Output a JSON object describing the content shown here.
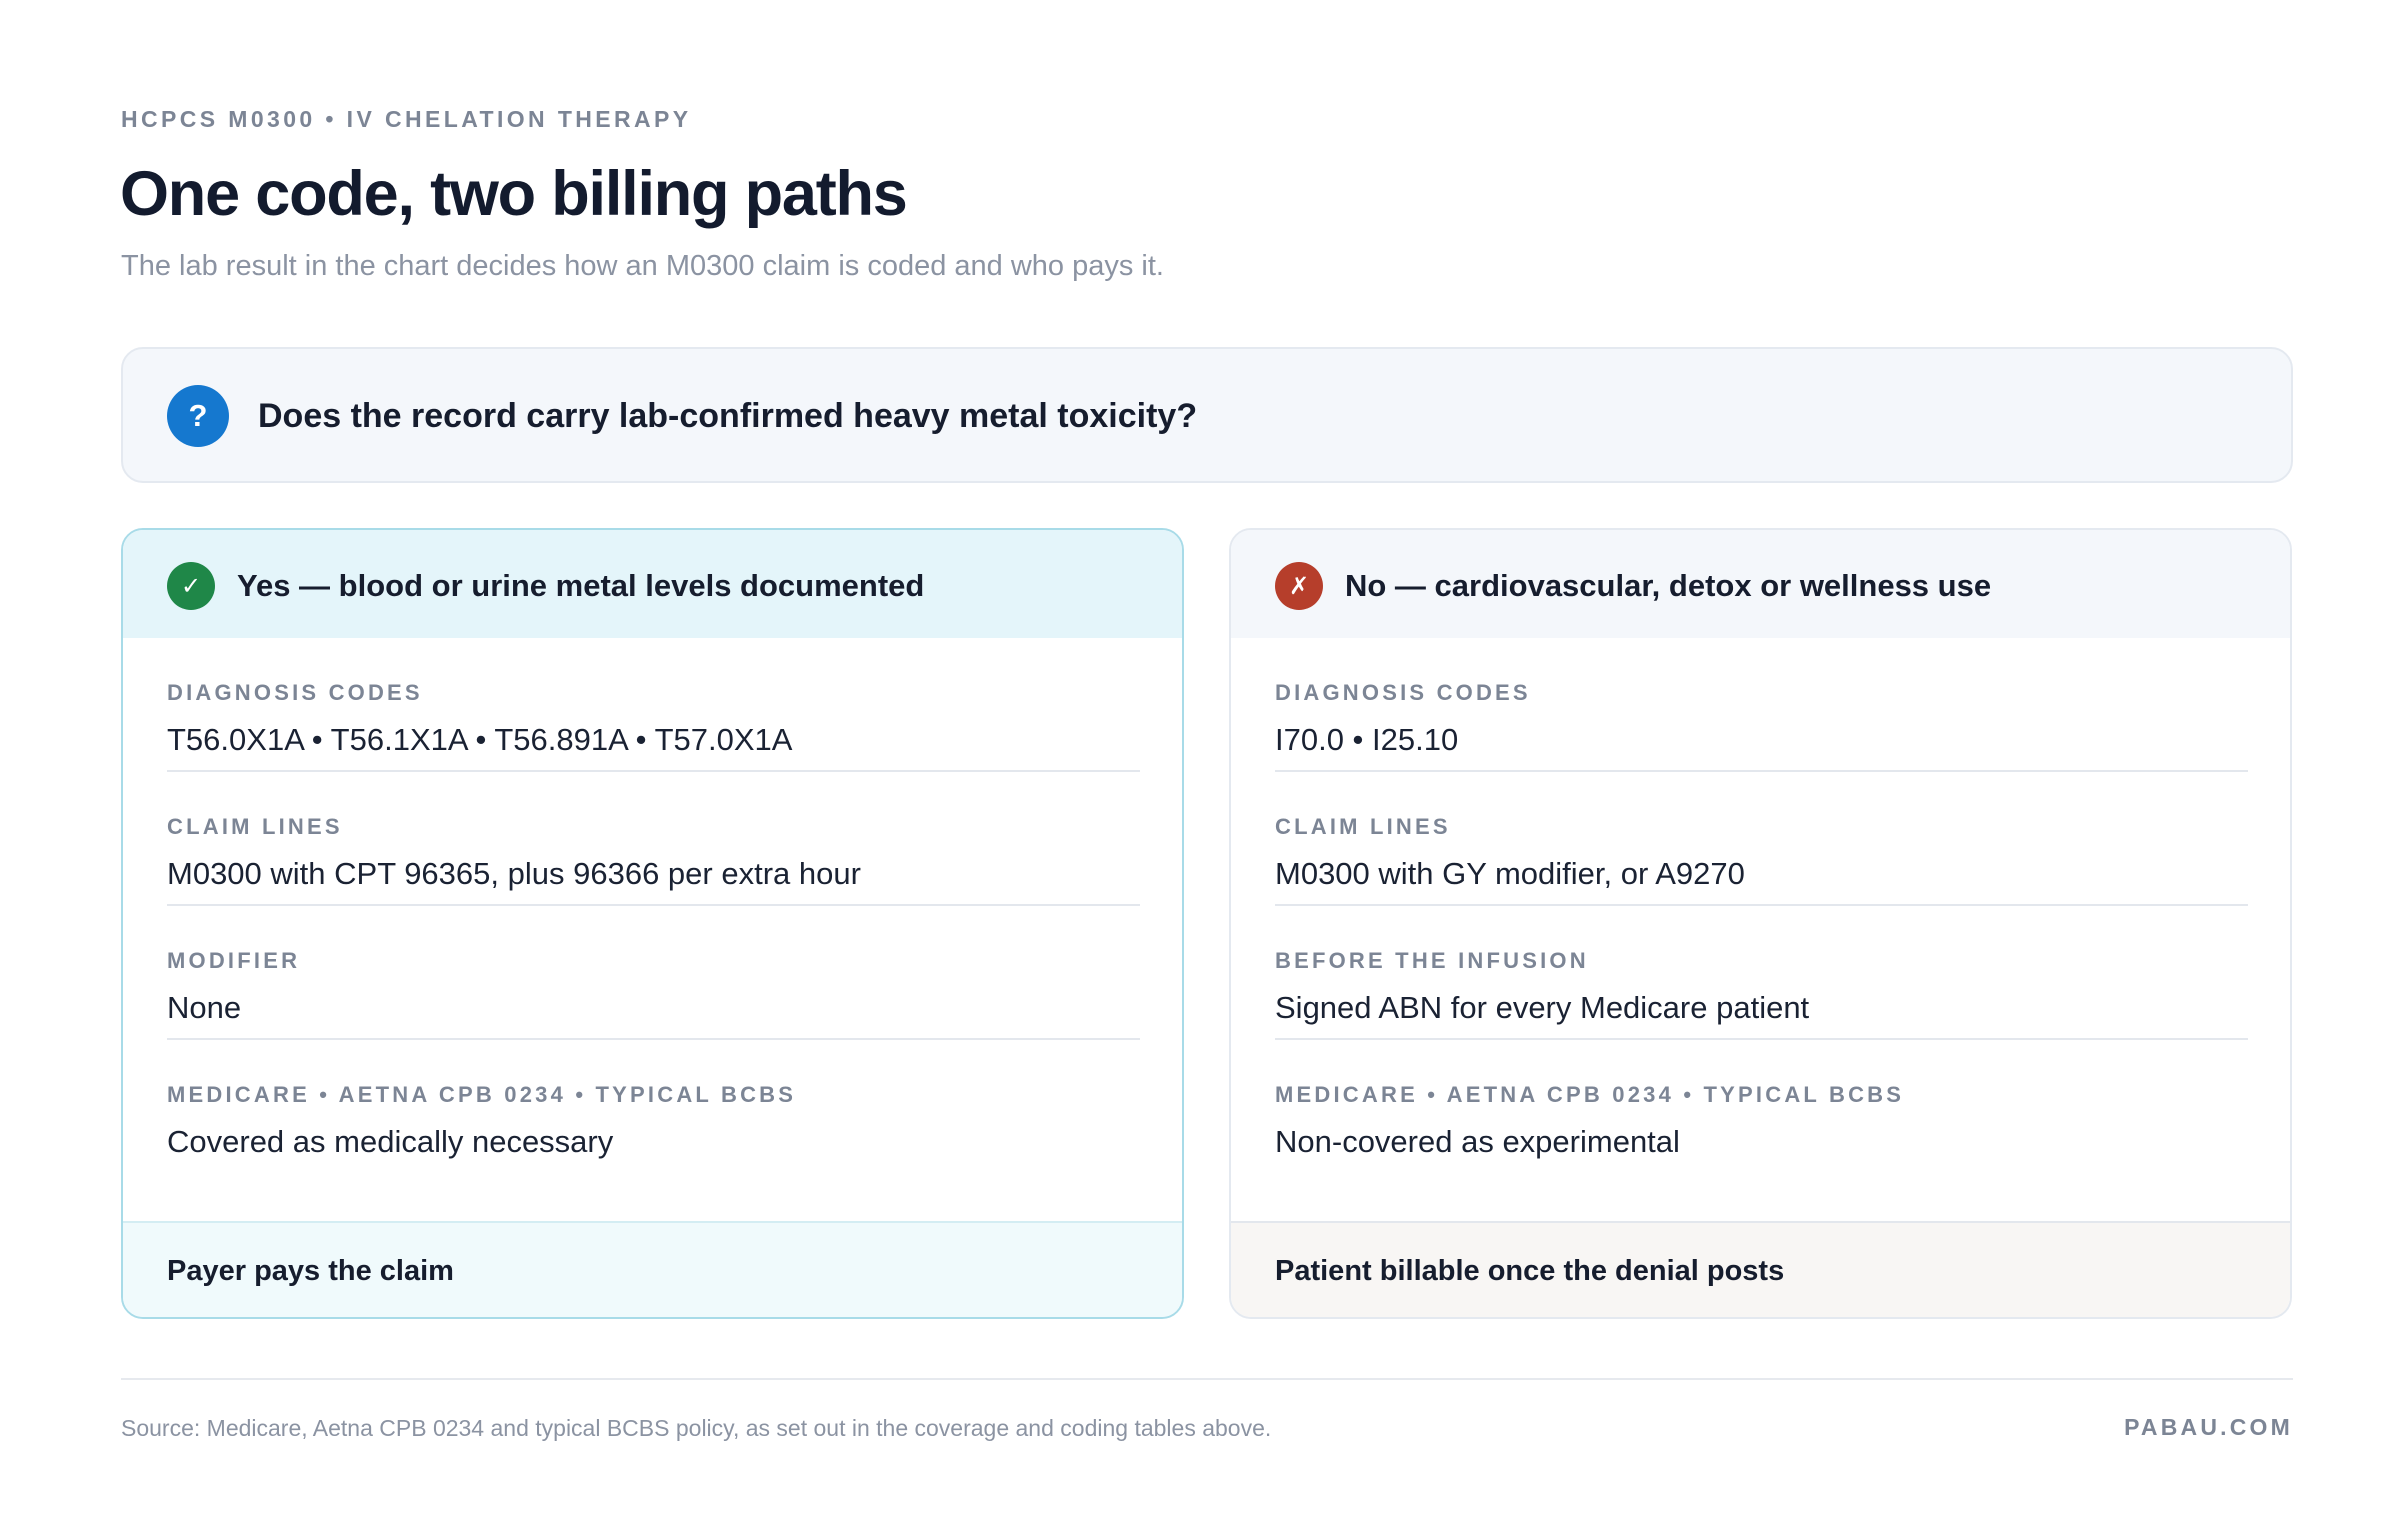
{
  "header": {
    "eyebrow": "HCPCS M0300 • IV CHELATION THERAPY",
    "title": "One code, two billing paths",
    "subtitle": "The lab result in the chart decides how an M0300 claim is coded and who pays it."
  },
  "question": {
    "icon": "question-mark-icon",
    "badge": "?",
    "text": "Does the record carry lab-confirmed heavy metal toxicity?",
    "color": "#1578cf"
  },
  "paths": {
    "yes": {
      "icon": "check-icon",
      "badge": "✓",
      "color": "#1f8748",
      "heading": "Yes — blood or urine metal levels documented",
      "rows": [
        {
          "label": "DIAGNOSIS CODES",
          "value": "T56.0X1A • T56.1X1A • T56.891A • T57.0X1A"
        },
        {
          "label": "CLAIM LINES",
          "value": "M0300 with CPT 96365, plus 96366 per extra hour"
        },
        {
          "label": "MODIFIER",
          "value": "None"
        },
        {
          "label": "MEDICARE • AETNA CPB 0234 • TYPICAL BCBS",
          "value": "Covered as medically necessary"
        }
      ],
      "outcome": "Payer pays the claim"
    },
    "no": {
      "icon": "cross-icon",
      "badge": "✗",
      "color": "#b63e2b",
      "heading": "No — cardiovascular, detox or wellness use",
      "rows": [
        {
          "label": "DIAGNOSIS CODES",
          "value": "I70.0 • I25.10"
        },
        {
          "label": "CLAIM LINES",
          "value": "M0300 with GY modifier, or A9270"
        },
        {
          "label": "BEFORE THE INFUSION",
          "value": "Signed ABN for every Medicare patient"
        },
        {
          "label": "MEDICARE • AETNA CPB 0234 • TYPICAL BCBS",
          "value": "Non-covered as experimental"
        }
      ],
      "outcome": "Patient billable once the denial posts"
    }
  },
  "footer": {
    "source": "Source: Medicare, Aetna CPB 0234 and typical BCBS policy, as set out in the coverage and coding tables above.",
    "brand": "PABAU.COM"
  }
}
